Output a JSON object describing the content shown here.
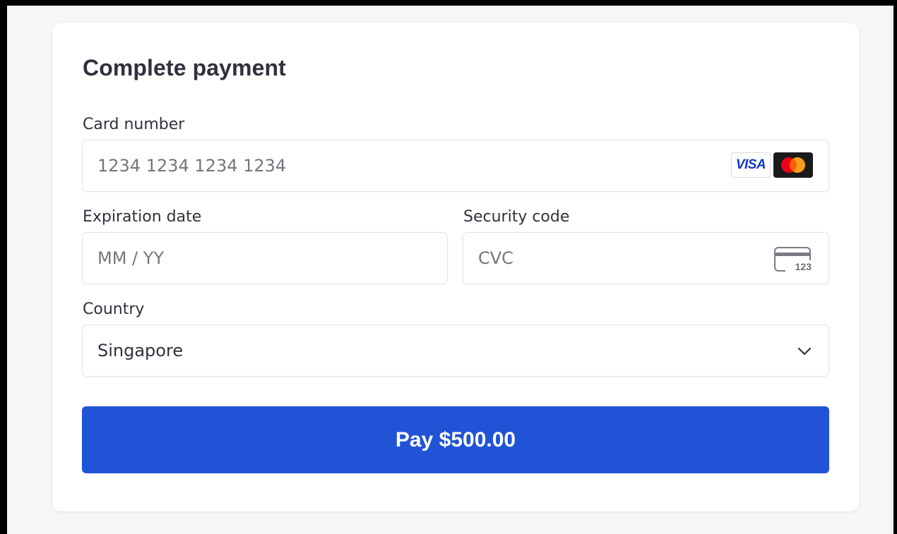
{
  "form": {
    "title": "Complete payment",
    "card_number": {
      "label": "Card number",
      "placeholder": "1234 1234 1234 1234",
      "value": "",
      "brands": [
        {
          "name": "visa",
          "text": "VISA",
          "icon": "visa-logo-icon"
        },
        {
          "name": "mastercard",
          "icon": "mastercard-logo-icon"
        }
      ]
    },
    "expiration": {
      "label": "Expiration date",
      "placeholder": "MM / YY",
      "value": ""
    },
    "security_code": {
      "label": "Security code",
      "placeholder": "CVC",
      "value": "",
      "icon": "card-cvc-icon",
      "icon_text": "123"
    },
    "country": {
      "label": "Country",
      "selected": "Singapore",
      "icon": "chevron-down-icon"
    },
    "pay_button": {
      "label": "Pay $500.00"
    }
  },
  "colors": {
    "page_background": "#f5f6f8",
    "card_background": "#ffffff",
    "text": "#30313d",
    "placeholder": "#75767f",
    "border": "#e3e3e8",
    "button_accent": "#2053d6",
    "button_text": "#ffffff",
    "visa_blue": "#1434cb",
    "mastercard_red": "#eb001b",
    "mastercard_orange": "#f79e1b"
  }
}
